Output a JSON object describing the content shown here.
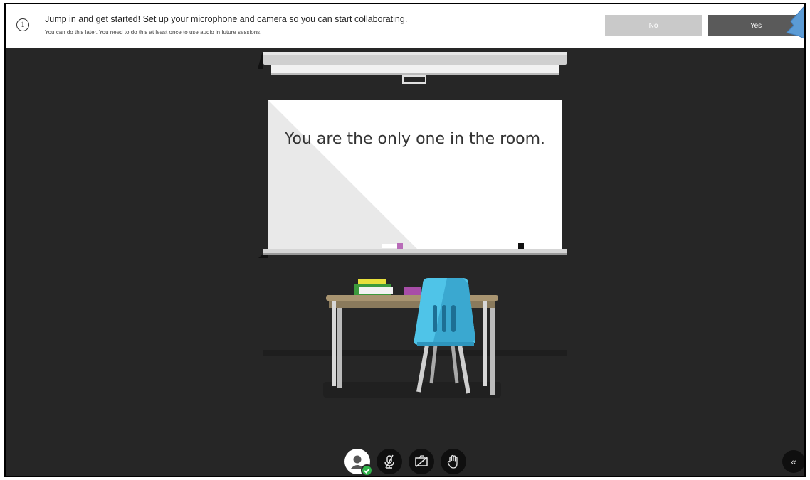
{
  "notification": {
    "icon": "info-icon",
    "info_glyph": "i",
    "message": "Jump in and get started! Set up your microphone and camera so you can start collaborating.",
    "sub_message": "You can do this later. You need to do this at least once to use audio in future sessions.",
    "no_label": "No",
    "yes_label": "Yes"
  },
  "room": {
    "screen_message": "You are the only one in the room."
  },
  "controls": [
    {
      "name": "avatar",
      "icon": "user-avatar-icon",
      "status": "ready"
    },
    {
      "name": "microphone",
      "icon": "microphone-muted-icon"
    },
    {
      "name": "camera",
      "icon": "camera-off-icon"
    },
    {
      "name": "raise-hand",
      "icon": "raise-hand-icon"
    }
  ],
  "collapse_panel": {
    "icon": "double-chevron-left-icon",
    "glyph": "«"
  },
  "colors": {
    "background": "#262626",
    "yes_button": "#5a5a5a",
    "no_button": "#c9c9c9",
    "status_green": "#31b44b",
    "chair_blue": "#4fc4e8"
  }
}
